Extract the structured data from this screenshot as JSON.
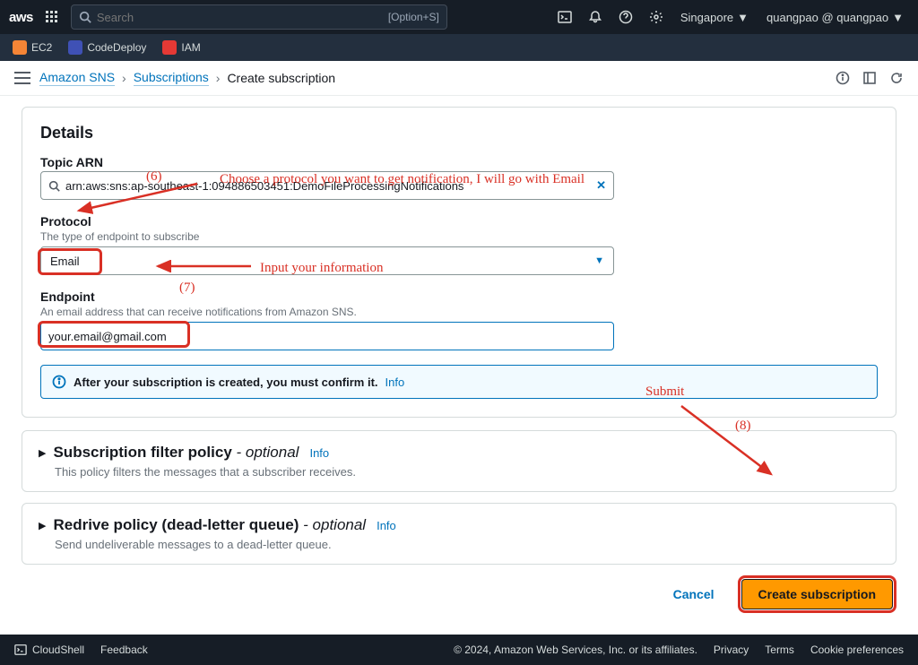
{
  "nav": {
    "logo": "aws",
    "search_placeholder": "Search",
    "shortcut": "[Option+S]",
    "region": "Singapore",
    "account": "quangpao @ quangpao"
  },
  "subnav": {
    "services": [
      {
        "label": "EC2",
        "icon_class": "ec2"
      },
      {
        "label": "CodeDeploy",
        "icon_class": "cdep"
      },
      {
        "label": "IAM",
        "icon_class": "iam"
      }
    ]
  },
  "breadcrumb": {
    "items": [
      "Amazon SNS",
      "Subscriptions",
      "Create subscription"
    ]
  },
  "details": {
    "heading": "Details",
    "topic_arn": {
      "label": "Topic ARN",
      "value": "arn:aws:sns:ap-southeast-1:094886503451:DemoFileProcessingNotifications"
    },
    "protocol": {
      "label": "Protocol",
      "help": "The type of endpoint to subscribe",
      "value": "Email"
    },
    "endpoint": {
      "label": "Endpoint",
      "help": "An email address that can receive notifications from Amazon SNS.",
      "value": "your.email@gmail.com"
    },
    "info_text": "After your subscription is created, you must confirm it.",
    "info_link": "Info"
  },
  "filter_policy": {
    "title": "Subscription filter policy",
    "suffix": " - optional",
    "info": "Info",
    "desc": "This policy filters the messages that a subscriber receives."
  },
  "redrive": {
    "title": "Redrive policy (dead-letter queue)",
    "suffix": " - optional",
    "info": "Info",
    "desc": "Send undeliverable messages to a dead-letter queue."
  },
  "actions": {
    "cancel": "Cancel",
    "create": "Create subscription"
  },
  "annotations": {
    "a6_num": "(6)",
    "a6_text": "Choose a protocol you want to get notification, I will go with Email",
    "a7_num": "(7)",
    "a7_text": "Input your information",
    "a8_num": "(8)",
    "a8_text": "Submit"
  },
  "footer": {
    "cloudshell": "CloudShell",
    "feedback": "Feedback",
    "copyright": "© 2024, Amazon Web Services, Inc. or its affiliates.",
    "privacy": "Privacy",
    "terms": "Terms",
    "cookie": "Cookie preferences"
  }
}
